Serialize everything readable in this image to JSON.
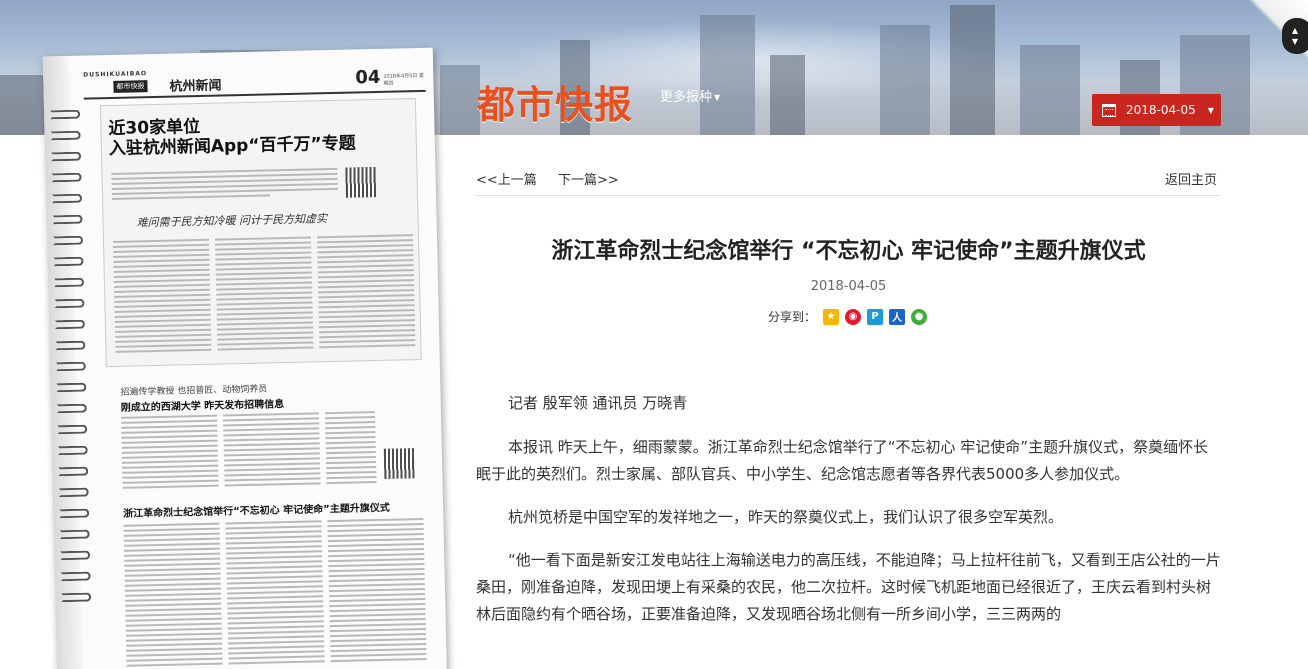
{
  "header": {
    "logo_text": "都市快报",
    "more_papers_label": "更多报种",
    "date_selector_value": "2018-04-05",
    "accent_color": "#c8261e",
    "logo_color": "#e8501f"
  },
  "thumbnail": {
    "brand_en": "DUSHIKUAIBAO",
    "brand_cn": "都市快报",
    "column": "杭州新闻",
    "page_number": "04",
    "print_date": "2018年4月5日 星期四",
    "headline_1a": "近30家单位",
    "headline_1b": "入驻杭州新闻App“百千万”专题",
    "signature": "难问需于民方知冷暖 问计于民方知虚实",
    "subhead_2": "招遍传学教授 也招普匠、动物饲养员",
    "headline_2": "刚成立的西湖大学 昨天发布招聘信息",
    "headline_3": "浙江革命烈士纪念馆举行“不忘初心 牢记使命”主题升旗仪式"
  },
  "nav": {
    "prev_label": "<<上一篇",
    "next_label": "下一篇>>",
    "home_label": "返回主页"
  },
  "article": {
    "title": "浙江革命烈士纪念馆举行 “不忘初心 牢记使命”主题升旗仪式",
    "date": "2018-04-05",
    "share_label": "分享到：",
    "share_icons": [
      "qzone-icon",
      "weibo-icon",
      "pengyou-icon",
      "renren-icon",
      "wechat-icon"
    ],
    "byline": "记者 殷军领 通讯员 万晓青",
    "paragraphs": [
      "本报讯 昨天上午，细雨蒙蒙。浙江革命烈士纪念馆举行了“不忘初心 牢记使命”主题升旗仪式，祭奠缅怀长眠于此的英烈们。烈士家属、部队官兵、中小学生、纪念馆志愿者等各界代表5000多人参加仪式。",
      "杭州笕桥是中国空军的发祥地之一，昨天的祭奠仪式上，我们认识了很多空军英烈。",
      "“他一看下面是新安江发电站往上海输送电力的高压线，不能迫降；马上拉杆往前飞，又看到王店公社的一片桑田，刚准备迫降，发现田埂上有采桑的农民，他二次拉杆。这时候飞机距地面已经很近了，王庆云看到村头树林后面隐约有个晒谷场，正要准备迫降，又发现晒谷场北侧有一所乡间小学，三三两两的"
    ]
  }
}
